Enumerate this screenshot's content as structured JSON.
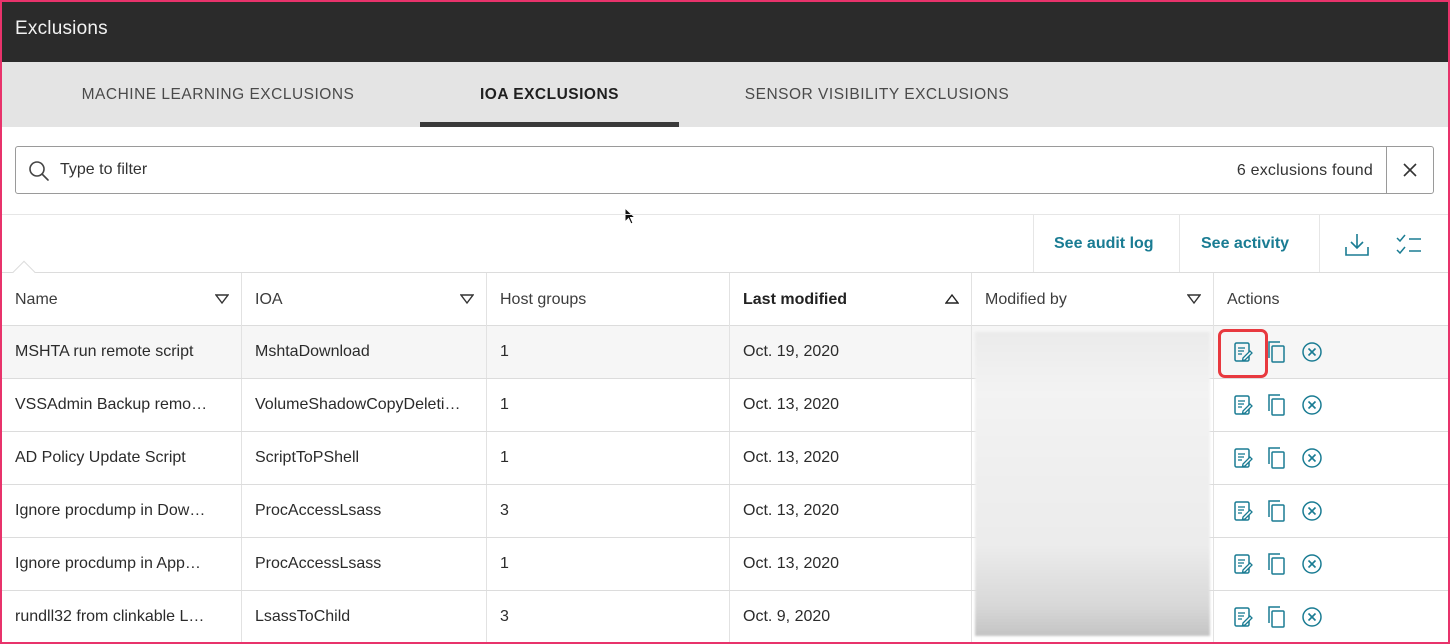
{
  "window": {
    "title": "Exclusions"
  },
  "tabs": [
    {
      "label": "MACHINE LEARNING EXCLUSIONS",
      "active": false
    },
    {
      "label": "IOA EXCLUSIONS",
      "active": true
    },
    {
      "label": "SENSOR VISIBILITY EXCLUSIONS",
      "active": false
    }
  ],
  "filter": {
    "placeholder": "Type to filter",
    "value": "",
    "count_text": "6 exclusions found"
  },
  "toolbar": {
    "audit_log": "See audit log",
    "activity": "See activity"
  },
  "table": {
    "columns": [
      "Name",
      "IOA",
      "Host groups",
      "Last modified",
      "Modified by",
      "Actions"
    ],
    "sorted_column": "Last modified",
    "rows": [
      {
        "name": "MSHTA run remote script",
        "ioa": "MshtaDownload",
        "host_groups": "1",
        "last_modified": "Oct. 19, 2020"
      },
      {
        "name": "VSSAdmin Backup remo…",
        "ioa": "VolumeShadowCopyDeleti…",
        "host_groups": "1",
        "last_modified": "Oct. 13, 2020"
      },
      {
        "name": "AD Policy Update Script",
        "ioa": "ScriptToPShell",
        "host_groups": "1",
        "last_modified": "Oct. 13, 2020"
      },
      {
        "name": "Ignore procdump in Dow…",
        "ioa": "ProcAccessLsass",
        "host_groups": "3",
        "last_modified": "Oct. 13, 2020"
      },
      {
        "name": "Ignore procdump in App…",
        "ioa": "ProcAccessLsass",
        "host_groups": "1",
        "last_modified": "Oct. 13, 2020"
      },
      {
        "name": "rundll32 from clinkable L…",
        "ioa": "LsassToChild",
        "host_groups": "3",
        "last_modified": "Oct. 9, 2020"
      }
    ]
  },
  "icons": {
    "search": "search-icon",
    "clear": "close-icon",
    "download": "download-icon",
    "bulk": "checklist-icon",
    "edit": "edit-icon",
    "copy": "copy-icon",
    "delete": "delete-circle-icon"
  },
  "colors": {
    "accent": "#1a7c93",
    "titlebar": "#2b2b2b",
    "highlight": "#e8393f"
  }
}
